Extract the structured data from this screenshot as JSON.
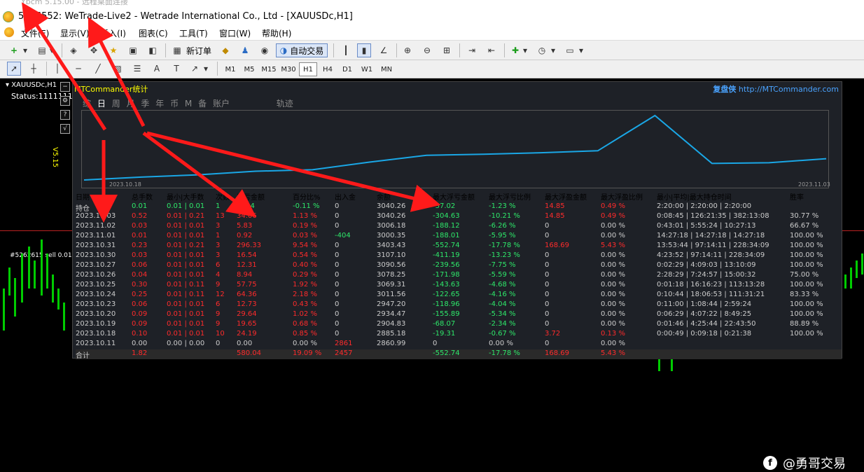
{
  "window": {
    "old_title": "Ybcm 5.15.00 - 远程桌面连接",
    "title": "5146552: WeTrade-Live2 - Wetrade International Co., Ltd - [XAUUSDc,H1]"
  },
  "menu": [
    "文件(F)",
    "显示(V)",
    "插入(I)",
    "图表(C)",
    "工具(T)",
    "窗口(W)",
    "帮助(H)"
  ],
  "toolbar": {
    "new_order": "新订单",
    "auto_trade": "自动交易"
  },
  "timeframes": [
    "M1",
    "M5",
    "M15",
    "M30",
    "H1",
    "H4",
    "D1",
    "W1",
    "MN"
  ],
  "active_timeframe": "H1",
  "chart": {
    "symbol_label": "XAUUSDc,H1",
    "status": "Status:1111111",
    "order_label": "#5262615 sell 0.01",
    "version": "V5.15"
  },
  "panel": {
    "title": "MTCommander统计",
    "brand_name": "复盘侠",
    "brand_url": "http://MTCommander.com",
    "tabs": [
      "综",
      "日",
      "周",
      "月",
      "季",
      "年",
      "币",
      "M",
      "备",
      "账户",
      "轨迹"
    ],
    "active_tab": "日",
    "plot_start_date": "2023.10.18",
    "plot_end_date": "2023.11.03",
    "columns": [
      "日期",
      "总手数",
      "最小|大手数",
      "次数",
      "盈亏金额",
      "百分比%",
      "出入金",
      "余额",
      "最大浮亏金额",
      "最大浮亏比例",
      "最大浮盈金额",
      "最大浮盈比例",
      "最小|平均|最大持仓时间",
      "胜率"
    ],
    "rows": [
      [
        "持仓",
        "0.01",
        "0.01 | 0.01",
        "1",
        "-3.24",
        "-0.11 %",
        "0",
        "3040.26",
        "-37.02",
        "-1.23 %",
        "14.85",
        "0.49 %",
        "2:20:00 | 2:20:00 | 2:20:00",
        ""
      ],
      [
        "2023.11.03",
        "0.52",
        "0.01 | 0.21",
        "13",
        "34.06",
        "1.13 %",
        "0",
        "3040.26",
        "-304.63",
        "-10.21 %",
        "14.85",
        "0.49 %",
        "0:08:45 | 126:21:35 | 382:13:08",
        "30.77 %"
      ],
      [
        "2023.11.02",
        "0.03",
        "0.01 | 0.01",
        "3",
        "5.83",
        "0.19 %",
        "0",
        "3006.18",
        "-188.12",
        "-6.26 %",
        "0",
        "0.00 %",
        "0:43:01 | 5:55:24 | 10:27:13",
        "66.67 %"
      ],
      [
        "2023.11.01",
        "0.01",
        "0.01 | 0.01",
        "1",
        "0.92",
        "0.03 %",
        "-404",
        "3000.35",
        "-188.01",
        "-5.95 %",
        "0",
        "0.00 %",
        "14:27:18 | 14:27:18 | 14:27:18",
        "100.00 %"
      ],
      [
        "2023.10.31",
        "0.23",
        "0.01 | 0.21",
        "3",
        "296.33",
        "9.54 %",
        "0",
        "3403.43",
        "-552.74",
        "-17.78 %",
        "168.69",
        "5.43 %",
        "13:53:44 | 97:14:11 | 228:34:09",
        "100.00 %"
      ],
      [
        "2023.10.30",
        "0.03",
        "0.01 | 0.01",
        "3",
        "16.54",
        "0.54 %",
        "0",
        "3107.10",
        "-411.19",
        "-13.23 %",
        "0",
        "0.00 %",
        "4:23:52 | 97:14:11 | 228:34:09",
        "100.00 %"
      ],
      [
        "2023.10.27",
        "0.06",
        "0.01 | 0.01",
        "6",
        "12.31",
        "0.40 %",
        "0",
        "3090.56",
        "-239.56",
        "-7.75 %",
        "0",
        "0.00 %",
        "0:02:29 | 4:09:03 | 13:10:09",
        "100.00 %"
      ],
      [
        "2023.10.26",
        "0.04",
        "0.01 | 0.01",
        "4",
        "8.94",
        "0.29 %",
        "0",
        "3078.25",
        "-171.98",
        "-5.59 %",
        "0",
        "0.00 %",
        "2:28:29 | 7:24:57 | 15:00:32",
        "75.00 %"
      ],
      [
        "2023.10.25",
        "0.30",
        "0.01 | 0.11",
        "9",
        "57.75",
        "1.92 %",
        "0",
        "3069.31",
        "-143.63",
        "-4.68 %",
        "0",
        "0.00 %",
        "0:01:18 | 16:16:23 | 113:13:28",
        "100.00 %"
      ],
      [
        "2023.10.24",
        "0.25",
        "0.01 | 0.11",
        "12",
        "64.36",
        "2.18 %",
        "0",
        "3011.56",
        "-122.65",
        "-4.16 %",
        "0",
        "0.00 %",
        "0:10:44 | 18:06:53 | 111:31:21",
        "83.33 %"
      ],
      [
        "2023.10.23",
        "0.06",
        "0.01 | 0.01",
        "6",
        "12.73",
        "0.43 %",
        "0",
        "2947.20",
        "-118.96",
        "-4.04 %",
        "0",
        "0.00 %",
        "0:11:00 | 1:08:44 | 2:59:24",
        "100.00 %"
      ],
      [
        "2023.10.20",
        "0.09",
        "0.01 | 0.01",
        "9",
        "29.64",
        "1.02 %",
        "0",
        "2934.47",
        "-155.89",
        "-5.34 %",
        "0",
        "0.00 %",
        "0:06:29 | 4:07:22 | 8:49:25",
        "100.00 %"
      ],
      [
        "2023.10.19",
        "0.09",
        "0.01 | 0.01",
        "9",
        "19.65",
        "0.68 %",
        "0",
        "2904.83",
        "-68.07",
        "-2.34 %",
        "0",
        "0.00 %",
        "0:01:46 | 4:25:44 | 22:43:50",
        "88.89 %"
      ],
      [
        "2023.10.18",
        "0.10",
        "0.01 | 0.01",
        "10",
        "24.19",
        "0.85 %",
        "0",
        "2885.18",
        "-19.31",
        "-0.67 %",
        "3.72",
        "0.13 %",
        "0:00:49 | 0:09:18 | 0:21:38",
        "100.00 %"
      ],
      [
        "2023.10.11",
        "0.00",
        "0.00 | 0.00",
        "0",
        "0.00",
        "0.00 %",
        "2861",
        "2860.99",
        "0",
        "0.00 %",
        "0",
        "0.00 %",
        "",
        ""
      ]
    ],
    "total": [
      "合计",
      "1.82",
      "",
      "",
      "580.04",
      "19.09 %",
      "2457",
      "",
      "-552.74",
      "-17.78 %",
      "168.69",
      "5.43 %",
      "",
      ""
    ],
    "balance_curve": [
      2860.99,
      2885.18,
      2904.83,
      2934.47,
      2947.2,
      3011.56,
      3069.31,
      3078.25,
      3090.56,
      3107.1,
      3403.43,
      3000.35,
      3006.18,
      3040.26
    ]
  },
  "watermark": "@勇哥交易",
  "colors": {
    "profit": "#2ee86a",
    "loss": "#ff2b2b",
    "curve": "#1aa7e6",
    "annotation": "#ff1a1a"
  }
}
